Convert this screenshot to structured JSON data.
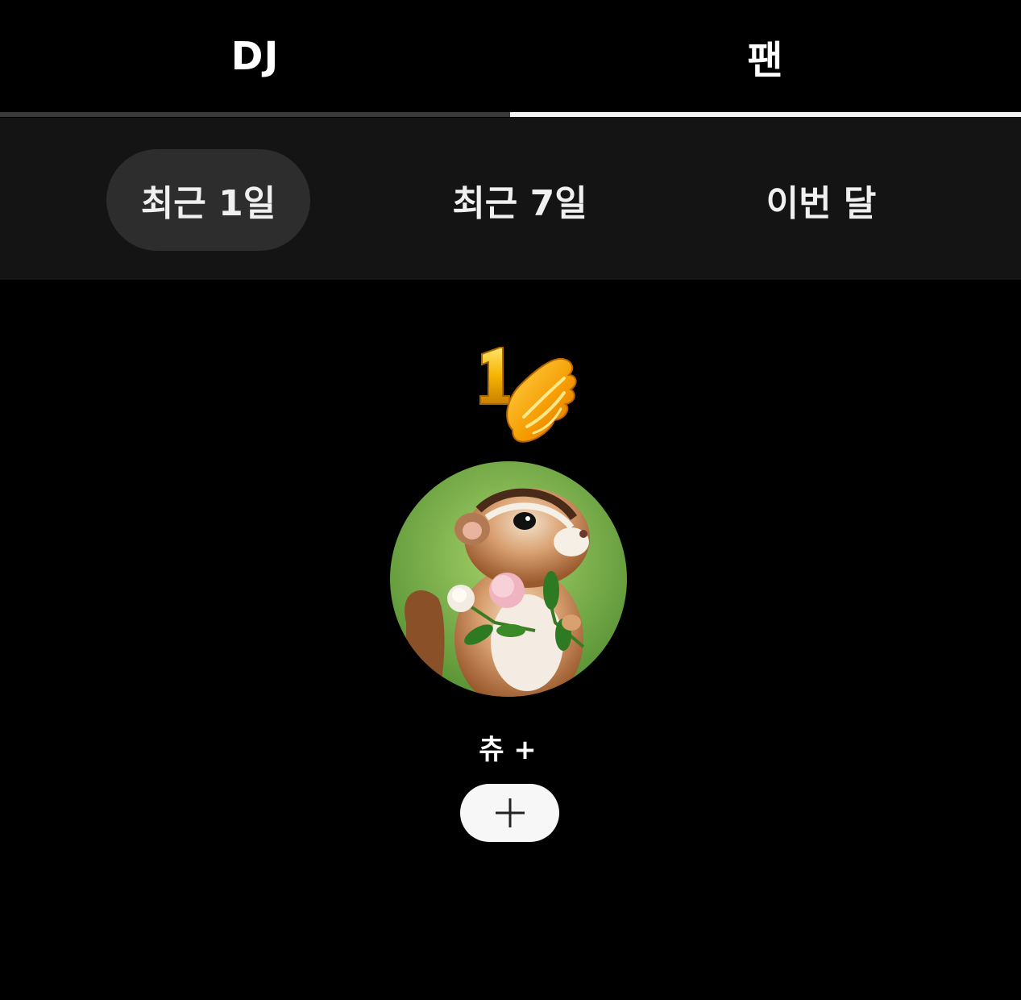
{
  "tabs": {
    "dj_label": "DJ",
    "fan_label": "팬",
    "active": "fan"
  },
  "period_filter": {
    "options": [
      "최근 1일",
      "최근 7일",
      "이번 달"
    ],
    "selected": "최근 1일"
  },
  "ranking": {
    "rank": "1",
    "nickname": "츄 +",
    "avatar_icon": "chipmunk-avatar",
    "follow_icon": "plus-icon"
  },
  "colors": {
    "background": "#000000",
    "filter_bar": "#141414",
    "selected_pill": "#2d2d2d",
    "active_tab_indicator": "#f2f2f2",
    "badge_gold": "#f5b400",
    "follow_button": "#f7f7f7"
  }
}
